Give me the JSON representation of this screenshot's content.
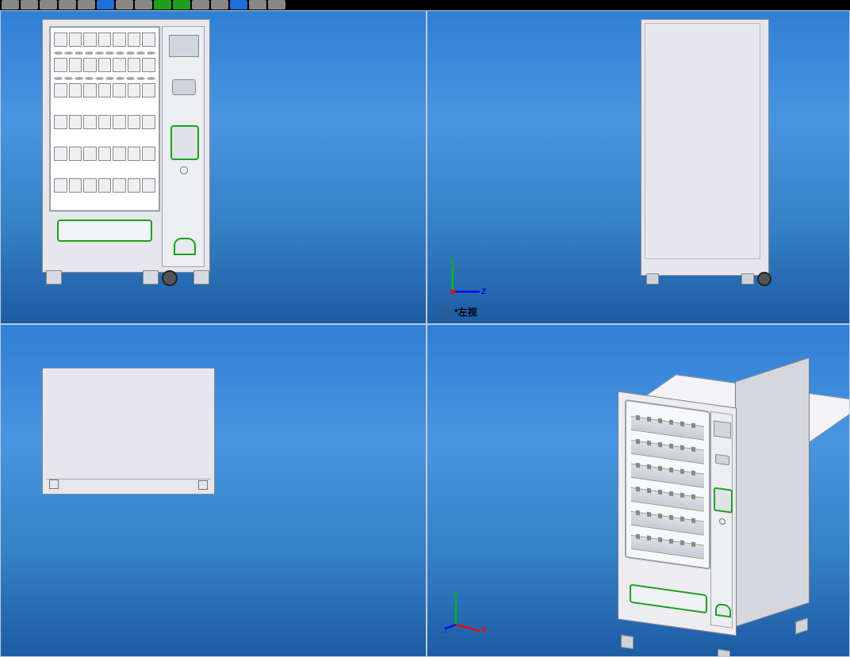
{
  "toolbar": {
    "buttons": [
      "b1",
      "b2",
      "b3",
      "b4",
      "b5",
      "b6",
      "b7",
      "b8",
      "b9",
      "b10",
      "b11",
      "b12",
      "b13",
      "b14",
      "b15"
    ]
  },
  "views": {
    "top_right_label": "*左视",
    "axes": {
      "x": "X",
      "y": "Y",
      "z": "Z"
    }
  },
  "model": {
    "name": "vending-machine",
    "shelf_rows": 6,
    "columns_per_row": 7,
    "accent_color": "#1fa01f",
    "body_color": "#e6e6ec"
  }
}
